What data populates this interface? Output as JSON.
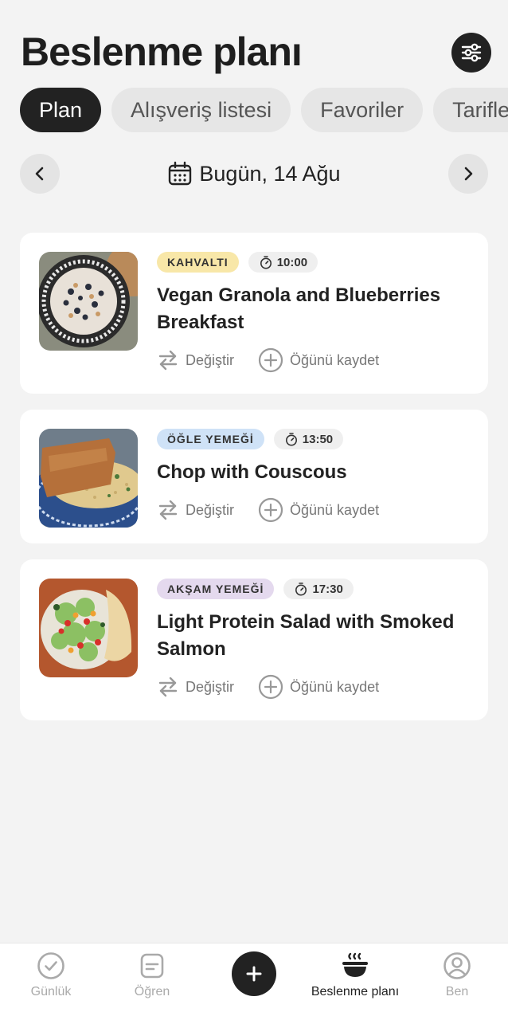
{
  "header": {
    "title": "Beslenme planı",
    "settings_icon": "sliders-icon"
  },
  "tabs": [
    {
      "label": "Plan",
      "active": true
    },
    {
      "label": "Alışveriş listesi",
      "active": false
    },
    {
      "label": "Favoriler",
      "active": false
    },
    {
      "label": "Tarifler",
      "active": false
    }
  ],
  "date_nav": {
    "label": "Bugün, 14 Ağu",
    "prev_icon": "chevron-left-icon",
    "next_icon": "chevron-right-icon",
    "calendar_icon": "calendar-icon"
  },
  "meals": [
    {
      "type": "KAHVALTI",
      "type_color": "#f8e7a8",
      "time": "10:00",
      "title": "Vegan Granola and Blueberries Breakfast",
      "swap_label": "Değiştir",
      "save_label": "Öğünü kaydet"
    },
    {
      "type": "ÖĞLE YEMEĞİ",
      "type_color": "#cfe2f7",
      "time": "13:50",
      "title": "Chop with Couscous",
      "swap_label": "Değiştir",
      "save_label": "Öğünü kaydet"
    },
    {
      "type": "AKŞAM YEMEĞİ",
      "type_color": "#e4d9ee",
      "time": "17:30",
      "title": "Light Protein Salad with Smoked Salmon",
      "swap_label": "Değiştir",
      "save_label": "Öğünü kaydet"
    }
  ],
  "bottom_nav": [
    {
      "label": "Günlük",
      "icon": "check-circle-icon",
      "active": false
    },
    {
      "label": "Öğren",
      "icon": "document-icon",
      "active": false
    },
    {
      "label": "",
      "icon": "plus-icon",
      "active": false
    },
    {
      "label": "Beslenme planı",
      "icon": "bowl-icon",
      "active": true
    },
    {
      "label": "Ben",
      "icon": "user-circle-icon",
      "active": false
    }
  ],
  "colors": {
    "accent": "#222222",
    "background": "#f3f3f3",
    "card": "#ffffff"
  }
}
